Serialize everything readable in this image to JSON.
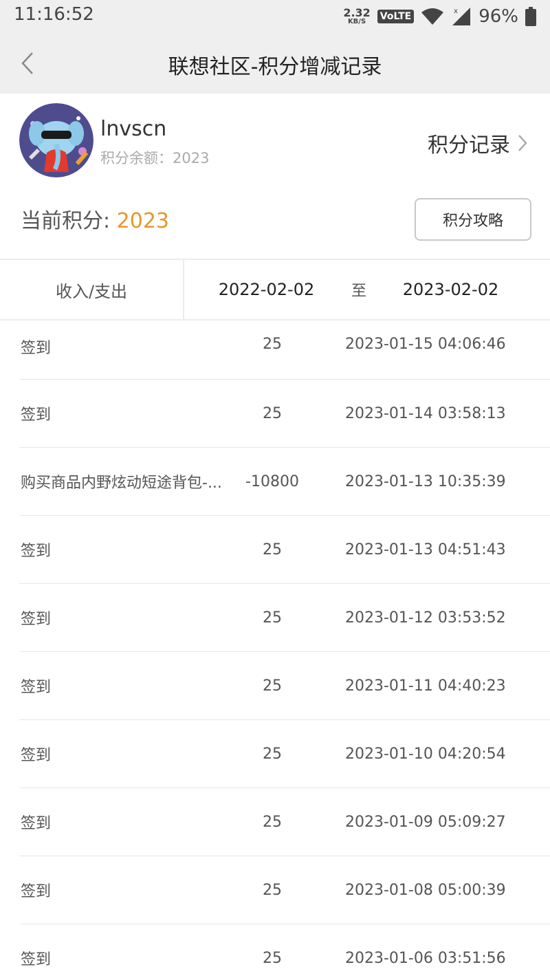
{
  "status_bar": {
    "time": "11:16:52",
    "net_speed_value": "2.32",
    "net_speed_unit": "KB/S",
    "volte": "VoLTE",
    "battery": "96%"
  },
  "nav": {
    "title": "联想社区-积分增减记录",
    "back_icon": "chevron-left-icon"
  },
  "profile": {
    "username": "lnvscn",
    "balance_label": "积分余额：2023",
    "record_link": "积分记录",
    "current_points_label": "当前积分: ",
    "current_points_value": "2023",
    "guide_button": "积分攻略"
  },
  "filter": {
    "type_label": "收入/支出",
    "date_start": "2022-02-02",
    "date_separator": "至",
    "date_end": "2023-02-02"
  },
  "records": [
    {
      "desc": "签到",
      "amount": "25",
      "time": "2023-01-15 04:06:46"
    },
    {
      "desc": "签到",
      "amount": "25",
      "time": "2023-01-14 03:58:13"
    },
    {
      "desc": "购买商品内野炫动短途背包-...",
      "amount": "-10800",
      "time": "2023-01-13 10:35:39"
    },
    {
      "desc": "签到",
      "amount": "25",
      "time": "2023-01-13 04:51:43"
    },
    {
      "desc": "签到",
      "amount": "25",
      "time": "2023-01-12 03:53:52"
    },
    {
      "desc": "签到",
      "amount": "25",
      "time": "2023-01-11 04:40:23"
    },
    {
      "desc": "签到",
      "amount": "25",
      "time": "2023-01-10 04:20:54"
    },
    {
      "desc": "签到",
      "amount": "25",
      "time": "2023-01-09 05:09:27"
    },
    {
      "desc": "签到",
      "amount": "25",
      "time": "2023-01-08 05:00:39"
    },
    {
      "desc": "签到",
      "amount": "25",
      "time": "2023-01-06 03:51:56"
    }
  ],
  "colors": {
    "accent": "#e8962c",
    "header_bg": "#efefef",
    "divider": "#e6e6e6"
  }
}
